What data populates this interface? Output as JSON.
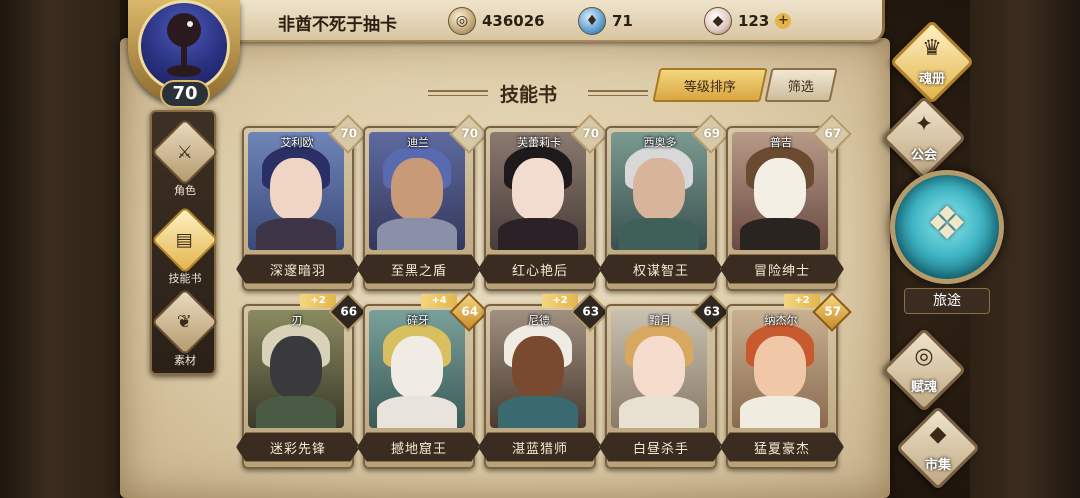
{
  "player": {
    "name": "非酋不死于抽卡",
    "level": "70"
  },
  "resources": {
    "gold": "436026",
    "crystal": "71",
    "gem": "123",
    "gem_plus": "+"
  },
  "left_nav": [
    {
      "label": "角色",
      "icon": "helmet-icon",
      "active": false
    },
    {
      "label": "技能书",
      "icon": "book-icon",
      "active": true
    },
    {
      "label": "素材",
      "icon": "wings-icon",
      "active": false
    }
  ],
  "section_title": "技能书",
  "buttons": {
    "sort": "等级排序",
    "filter": "筛选"
  },
  "cards": [
    {
      "hero": "艾利欧",
      "level": "70",
      "plus": "",
      "name": "深邃暗羽"
    },
    {
      "hero": "迪兰",
      "level": "70",
      "plus": "",
      "name": "至黑之盾"
    },
    {
      "hero": "芙蕾莉卡",
      "level": "70",
      "plus": "",
      "name": "红心艳后"
    },
    {
      "hero": "西奥多",
      "level": "69",
      "plus": "",
      "name": "权谋智王"
    },
    {
      "hero": "普吉",
      "level": "67",
      "plus": "",
      "name": "冒险绅士"
    },
    {
      "hero": "刃",
      "level": "66",
      "plus": "+2",
      "name": "迷彩先锋"
    },
    {
      "hero": "碎牙",
      "level": "64",
      "plus": "+4",
      "name": "撼地窟王"
    },
    {
      "hero": "尼德",
      "level": "63",
      "plus": "+2",
      "name": "湛蓝猎师"
    },
    {
      "hero": "黯月",
      "level": "63",
      "plus": "",
      "name": "白昼杀手"
    },
    {
      "hero": "纳杰尔",
      "level": "57",
      "plus": "+2",
      "name": "猛夏豪杰"
    }
  ],
  "right_nav": {
    "book": "魂册",
    "guild": "公会",
    "journey": "旅途",
    "soul": "赋魂",
    "market": "市集"
  }
}
